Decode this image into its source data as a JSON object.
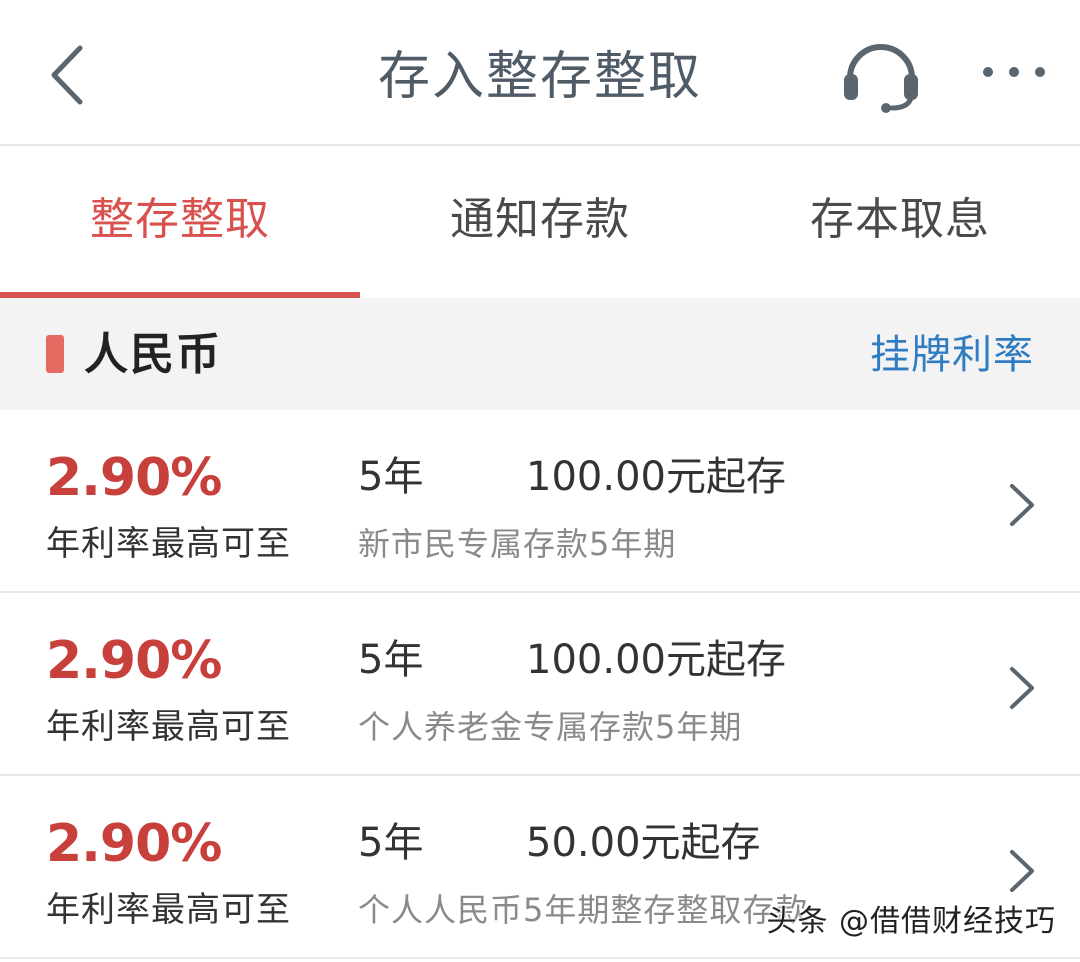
{
  "header": {
    "title": "存入整存整取",
    "back_icon": "chevron-left-icon",
    "service_icon": "headset-icon",
    "more_icon": "more-dots-icon"
  },
  "tabs": [
    {
      "label": "整存整取",
      "active": true
    },
    {
      "label": "通知存款",
      "active": false
    },
    {
      "label": "存本取息",
      "active": false
    }
  ],
  "section": {
    "title": "人民币",
    "link_label": "挂牌利率"
  },
  "products": [
    {
      "rate": "2.90%",
      "rate_label": "年利率最高可至",
      "term": "5年",
      "min_deposit": "100.00元起存",
      "name": "新市民专属存款5年期"
    },
    {
      "rate": "2.90%",
      "rate_label": "年利率最高可至",
      "term": "5年",
      "min_deposit": "100.00元起存",
      "name": "个人养老金专属存款5年期"
    },
    {
      "rate": "2.90%",
      "rate_label": "年利率最高可至",
      "term": "5年",
      "min_deposit": "50.00元起存",
      "name": "个人人民币5年期整存整取存款"
    }
  ],
  "watermark": "头条 @借借财经技巧",
  "colors": {
    "accent_red": "#d9514e",
    "rate_red": "#c8403c",
    "link_blue": "#2f7cc2",
    "header_text": "#4f5b66",
    "section_bg": "#f3f3f3"
  }
}
